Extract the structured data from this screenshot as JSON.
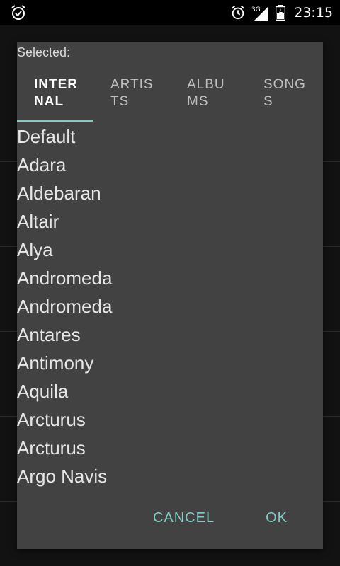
{
  "status_bar": {
    "time": "23:15",
    "network_type": "3G",
    "icons": [
      "alarm-clock-icon",
      "alarm-icon",
      "signal-icon",
      "battery-charging-icon"
    ]
  },
  "dialog": {
    "title": "Selected:",
    "tabs": [
      {
        "label": "INTER\nNAL",
        "active": true
      },
      {
        "label": "ARTIS\nTS",
        "active": false
      },
      {
        "label": "ALBU\nMS",
        "active": false
      },
      {
        "label": "SONG\nS",
        "active": false
      }
    ],
    "items": [
      "Default",
      "Adara",
      "Aldebaran",
      "Altair",
      "Alya",
      "Andromeda",
      "Andromeda",
      "Antares",
      "Antimony",
      "Aquila",
      "Arcturus",
      "Arcturus",
      "Argo Navis"
    ],
    "buttons": {
      "cancel": "CANCEL",
      "ok": "OK"
    }
  },
  "colors": {
    "accent": "#80cbc4",
    "dialog_bg": "#424242",
    "status_bar_bg": "#000000"
  }
}
